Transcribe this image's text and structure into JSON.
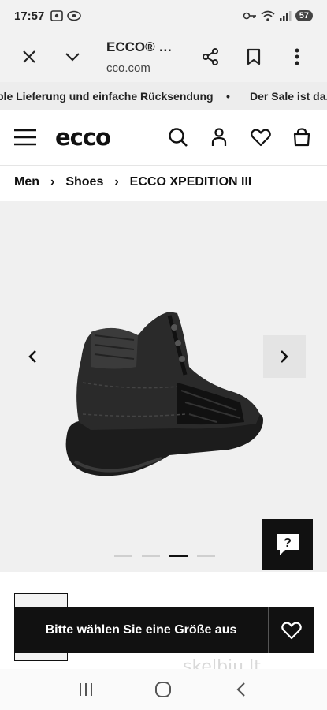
{
  "status_bar": {
    "time": "17:57",
    "battery": "57"
  },
  "browser": {
    "title": "ECCO® …",
    "url": "cco.com",
    "close_icon": "close-icon",
    "tabs_icon": "chevron-down-icon",
    "share_icon": "share-icon",
    "bookmark_icon": "bookmark-icon",
    "menu_icon": "more-vert-icon"
  },
  "promo": {
    "text_left": "ble Lieferung und einfache Rücksendung",
    "bullet": "•",
    "text_right": "Der Sale ist da."
  },
  "header": {
    "logo": "ecco",
    "icons": [
      "menu-icon",
      "search-icon",
      "account-icon",
      "heart-icon",
      "bag-icon"
    ]
  },
  "breadcrumb": {
    "items": [
      "Men",
      "Shoes",
      "ECCO XPEDITION III"
    ],
    "separator": "›"
  },
  "gallery": {
    "prev": "‹",
    "next": "›",
    "slide_count": 4,
    "active_index": 2,
    "help_label": "?"
  },
  "cta": {
    "select_size": "Bitte wählen Sie eine Größe aus"
  },
  "watermark": "skelbiu.lt",
  "colors": {
    "accent": "#111111",
    "background": "#ffffff",
    "gallery_bg": "#f0f0f0"
  }
}
